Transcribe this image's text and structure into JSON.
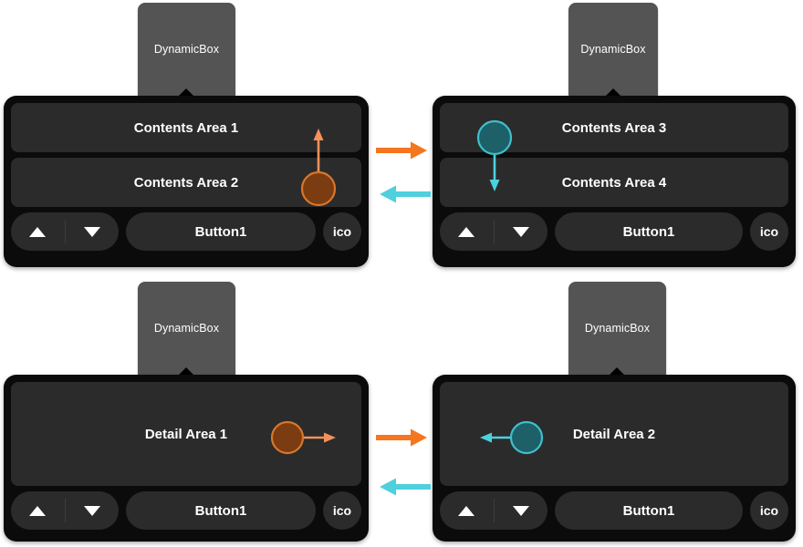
{
  "colors": {
    "background": "#ffffff",
    "device_body": "#0b0b0b",
    "content_area": "#2b2b2b",
    "tab_gray": "#545454",
    "text": "#ffffff",
    "orange_accent": "#f4761f",
    "orange_arrow_light": "#f4915a",
    "orange_circle_fill": "#7a3c10",
    "teal_accent": "#4ed0dd",
    "teal_circle_fill": "#1d6068",
    "teal_circle_stroke": "#3fbfcc"
  },
  "panels": [
    {
      "id": "top-left",
      "tab_label": "DynamicBox",
      "areas": [
        {
          "label": "Contents Area 1"
        },
        {
          "label": "Contents Area 2"
        }
      ],
      "footer": {
        "up_icon": "triangle-up-icon",
        "down_icon": "triangle-down-icon",
        "button_label": "Button1",
        "ico_label": "ico"
      },
      "marker": {
        "color": "orange",
        "shape": "circle-with-arrow",
        "direction": "up"
      }
    },
    {
      "id": "top-right",
      "tab_label": "DynamicBox",
      "areas": [
        {
          "label": "Contents Area 3"
        },
        {
          "label": "Contents Area 4"
        }
      ],
      "footer": {
        "up_icon": "triangle-up-icon",
        "down_icon": "triangle-down-icon",
        "button_label": "Button1",
        "ico_label": "ico"
      },
      "marker": {
        "color": "teal",
        "shape": "circle-with-arrow",
        "direction": "down"
      }
    },
    {
      "id": "bottom-left",
      "tab_label": "DynamicBox",
      "areas": [
        {
          "label": "Detail Area 1"
        }
      ],
      "footer": {
        "up_icon": "triangle-up-icon",
        "down_icon": "triangle-down-icon",
        "button_label": "Button1",
        "ico_label": "ico"
      },
      "marker": {
        "color": "orange",
        "shape": "circle-with-arrow",
        "direction": "right"
      }
    },
    {
      "id": "bottom-right",
      "tab_label": "DynamicBox",
      "areas": [
        {
          "label": "Detail Area 2"
        }
      ],
      "footer": {
        "up_icon": "triangle-up-icon",
        "down_icon": "triangle-down-icon",
        "button_label": "Button1",
        "ico_label": "ico"
      },
      "marker": {
        "color": "teal",
        "shape": "circle-with-arrow",
        "direction": "left"
      }
    }
  ],
  "transitions": [
    {
      "id": "top-forward",
      "direction": "right",
      "color": "#f4761f"
    },
    {
      "id": "top-back",
      "direction": "left",
      "color": "#4ed0dd"
    },
    {
      "id": "bottom-forward",
      "direction": "right",
      "color": "#f4761f"
    },
    {
      "id": "bottom-back",
      "direction": "left",
      "color": "#4ed0dd"
    }
  ]
}
